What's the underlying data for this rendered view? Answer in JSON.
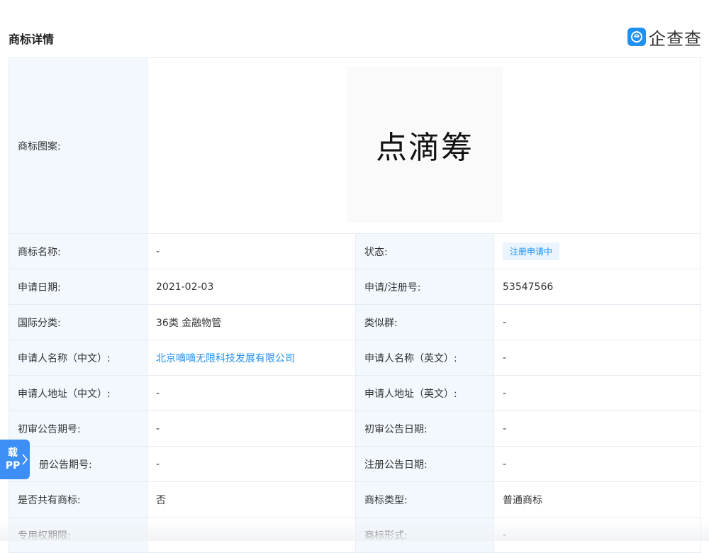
{
  "header": {
    "title": "商标详情",
    "brand_name": "企查查",
    "brand_color": "#1f8ff0"
  },
  "trademark_image": {
    "label": "商标图案:",
    "logo_text": "点滴筹"
  },
  "rows": [
    {
      "l1": "商标名称:",
      "v1": "-",
      "l2": "状态:",
      "v2": "注册申请中"
    },
    {
      "l1": "申请日期:",
      "v1": "2021-02-03",
      "l2": "申请/注册号:",
      "v2": "53547566"
    },
    {
      "l1": "国际分类:",
      "v1": "36类 金融物管",
      "l2": "类似群:",
      "v2": "-"
    },
    {
      "l1": "申请人名称（中文）:",
      "v1": "北京嘀嘀无限科技发展有限公司",
      "l2": "申请人名称（英文）:",
      "v2": "-"
    },
    {
      "l1": "申请人地址（中文）:",
      "v1": "-",
      "l2": "申请人地址（英文）:",
      "v2": "-"
    },
    {
      "l1": "初审公告期号:",
      "v1": "-",
      "l2": "初审公告日期:",
      "v2": "-"
    },
    {
      "l1": "册公告期号:",
      "v1": "-",
      "l2": "注册公告日期:",
      "v2": "-"
    },
    {
      "l1": "是否共有商标:",
      "v1": "否",
      "l2": "商标类型:",
      "v2": "普通商标"
    },
    {
      "l1": "专用权期限:",
      "v1": "",
      "l2": "商标形式:",
      "v2": "-"
    }
  ],
  "app_tab": {
    "line1": "载",
    "line2": "PP"
  },
  "colors": {
    "accent": "#1f8ff0",
    "label_bg": "#f2f8fe",
    "border": "#e6ecf3"
  }
}
